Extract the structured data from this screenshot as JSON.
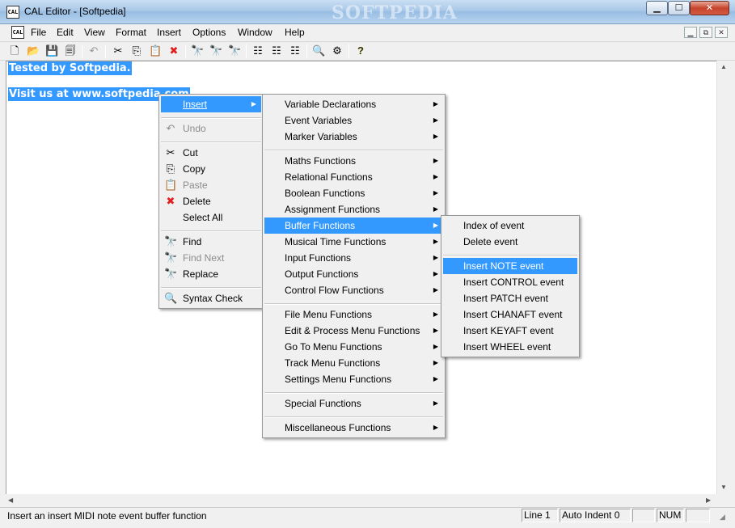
{
  "window": {
    "title": "CAL Editor - [Softpedia]",
    "watermark": "SOFTPEDIA",
    "icon_text": "CAL",
    "buttons": {
      "minimize": "▁",
      "maximize": "☐",
      "close": "✕"
    }
  },
  "menubar": {
    "items": [
      "File",
      "Edit",
      "View",
      "Format",
      "Insert",
      "Options",
      "Window",
      "Help"
    ],
    "mdi_buttons": [
      "▁",
      "⧉",
      "✕"
    ]
  },
  "toolbar": {
    "buttons": [
      {
        "icon": "new-file-icon",
        "glyph": "🗋"
      },
      {
        "icon": "open-folder-icon",
        "glyph": "📂"
      },
      {
        "icon": "save-icon",
        "glyph": "💾"
      },
      {
        "icon": "save-all-icon",
        "glyph": "🗐"
      },
      {
        "icon": "undo-icon",
        "glyph": "↶"
      },
      {
        "icon": "cut-icon",
        "glyph": "✂"
      },
      {
        "icon": "copy-icon",
        "glyph": "⎘"
      },
      {
        "icon": "paste-icon",
        "glyph": "📋"
      },
      {
        "icon": "delete-icon",
        "glyph": "✖"
      },
      {
        "icon": "find-icon",
        "glyph": "🔭"
      },
      {
        "icon": "find-next-icon",
        "glyph": "🔭"
      },
      {
        "icon": "replace-icon",
        "glyph": "🔭"
      },
      {
        "icon": "indent-icon",
        "glyph": "☷"
      },
      {
        "icon": "outdent-icon",
        "glyph": "☷"
      },
      {
        "icon": "comment-icon",
        "glyph": "☷"
      },
      {
        "icon": "syntax-check-icon",
        "glyph": "🔍"
      },
      {
        "icon": "tool-icon",
        "glyph": "⚙"
      },
      {
        "icon": "help-icon",
        "glyph": "?"
      }
    ]
  },
  "editor": {
    "lines": [
      "Tested by Softpedia.",
      "",
      "Visit us at www.softpedia.com"
    ]
  },
  "context_menu": {
    "items": [
      {
        "label": "Insert",
        "icon": "",
        "glyph": "",
        "state": "highlighted",
        "submenu": true
      },
      {
        "separator": true
      },
      {
        "label": "Undo",
        "icon": "undo-icon",
        "glyph": "↶",
        "state": "disabled"
      },
      {
        "separator": true
      },
      {
        "label": "Cut",
        "icon": "cut-icon",
        "glyph": "✂",
        "state": "enabled"
      },
      {
        "label": "Copy",
        "icon": "copy-icon",
        "glyph": "⎘",
        "state": "enabled"
      },
      {
        "label": "Paste",
        "icon": "paste-icon",
        "glyph": "📋",
        "state": "disabled"
      },
      {
        "label": "Delete",
        "icon": "delete-icon",
        "glyph": "✖",
        "state": "enabled"
      },
      {
        "label": "Select All",
        "icon": "",
        "glyph": "",
        "state": "enabled"
      },
      {
        "separator": true
      },
      {
        "label": "Find",
        "icon": "find-icon",
        "glyph": "🔭",
        "state": "enabled"
      },
      {
        "label": "Find Next",
        "icon": "find-next-icon",
        "glyph": "🔭",
        "state": "disabled"
      },
      {
        "label": "Replace",
        "icon": "replace-icon",
        "glyph": "🔭",
        "state": "enabled"
      },
      {
        "separator": true
      },
      {
        "label": "Syntax Check",
        "icon": "syntax-check-icon",
        "glyph": "🔍",
        "state": "enabled"
      }
    ]
  },
  "insert_submenu": {
    "items": [
      {
        "label": "Variable Declarations",
        "submenu": true
      },
      {
        "label": "Event Variables",
        "submenu": true
      },
      {
        "label": "Marker Variables",
        "submenu": true
      },
      {
        "separator": true
      },
      {
        "label": "Maths Functions",
        "submenu": true
      },
      {
        "label": "Relational Functions",
        "submenu": true
      },
      {
        "label": "Boolean Functions",
        "submenu": true
      },
      {
        "label": "Assignment Functions",
        "submenu": true
      },
      {
        "label": "Buffer Functions",
        "submenu": true,
        "state": "highlighted"
      },
      {
        "label": "Musical Time Functions",
        "submenu": true
      },
      {
        "label": "Input Functions",
        "submenu": true
      },
      {
        "label": "Output Functions",
        "submenu": true
      },
      {
        "label": "Control Flow Functions",
        "submenu": true
      },
      {
        "separator": true
      },
      {
        "label": "File Menu Functions",
        "submenu": true
      },
      {
        "label": "Edit & Process Menu Functions",
        "submenu": true
      },
      {
        "label": "Go To Menu Functions",
        "submenu": true
      },
      {
        "label": "Track Menu Functions",
        "submenu": true
      },
      {
        "label": "Settings Menu Functions",
        "submenu": true
      },
      {
        "separator": true
      },
      {
        "label": "Special Functions",
        "submenu": true
      },
      {
        "separator": true
      },
      {
        "label": "Miscellaneous Functions",
        "submenu": true
      }
    ]
  },
  "buffer_submenu": {
    "items": [
      {
        "label": "Index of event"
      },
      {
        "label": "Delete event"
      },
      {
        "separator": true
      },
      {
        "label": "Insert NOTE event",
        "state": "highlighted"
      },
      {
        "label": "Insert CONTROL event"
      },
      {
        "label": "Insert PATCH event"
      },
      {
        "label": "Insert CHANAFT event"
      },
      {
        "label": "Insert KEYAFT event"
      },
      {
        "label": "Insert WHEEL event"
      }
    ]
  },
  "statusbar": {
    "message": "Insert an insert MIDI note event buffer function",
    "panels": [
      "Line 1",
      "Auto Indent 0",
      "",
      "NUM",
      ""
    ]
  },
  "colors": {
    "highlight": "#3399ff",
    "menu_bg": "#f0f0f0",
    "disabled_text": "#8c8c8c",
    "delete_red": "#e02020"
  }
}
